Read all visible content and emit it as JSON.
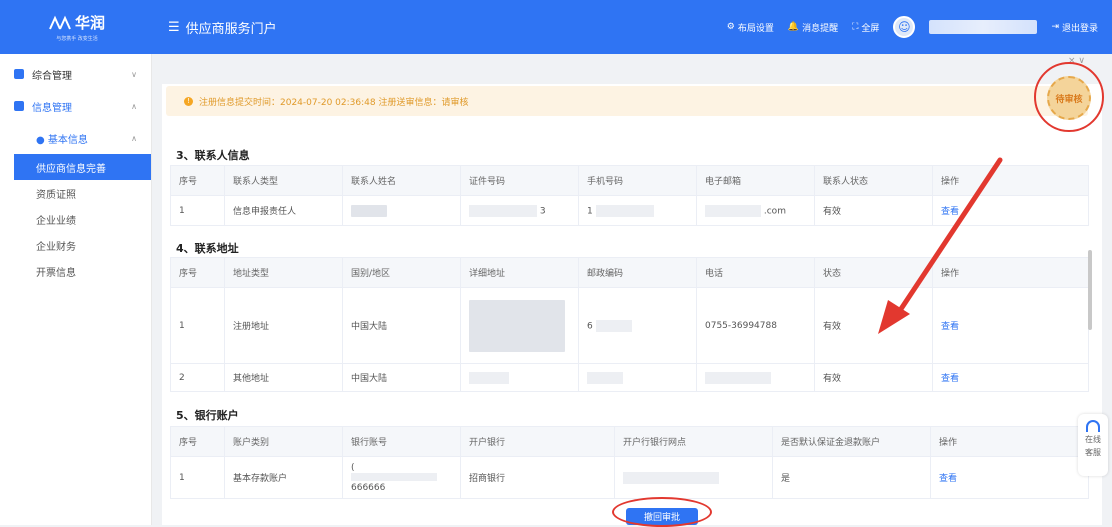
{
  "header": {
    "logo_text": "华润",
    "logo_sub": "与您携手 改变生活",
    "portal_title": "供应商服务门户",
    "layout_settings": "布局设置",
    "messages": "消息提醒",
    "fullscreen": "全屏",
    "logout": "退出登录"
  },
  "sidebar": {
    "items": [
      {
        "label": "综合管理"
      },
      {
        "label": "信息管理"
      },
      {
        "label": "● 基本信息"
      }
    ],
    "sub_items": [
      {
        "label": "供应商信息完善"
      },
      {
        "label": "资质证照"
      },
      {
        "label": "企业业绩"
      },
      {
        "label": "企业财务"
      },
      {
        "label": "开票信息"
      }
    ]
  },
  "notice": {
    "text": "注册信息提交时间：2024-07-20 02:36:48 注册送审信息：请审核"
  },
  "stamp": {
    "text": "待审核"
  },
  "contacts": {
    "title": "3、联系人信息",
    "headers": [
      "序号",
      "联系人类型",
      "联系人姓名",
      "证件号码",
      "手机号码",
      "电子邮箱",
      "联系人状态",
      "操作"
    ],
    "rows": [
      {
        "no": "1",
        "type": "信息申报责任人",
        "id_tail": "3",
        "phone_head": "1",
        "email_tail": ".com",
        "status": "有效",
        "action": "查看"
      }
    ]
  },
  "addresses": {
    "title": "4、联系地址",
    "headers": [
      "序号",
      "地址类型",
      "国别/地区",
      "详细地址",
      "邮政编码",
      "电话",
      "状态",
      "操作"
    ],
    "rows": [
      {
        "no": "1",
        "type": "注册地址",
        "region": "中国大陆",
        "postal_head": "6",
        "phone": "0755-36994788",
        "status": "有效",
        "action": "查看"
      },
      {
        "no": "2",
        "type": "其他地址",
        "region": "中国大陆",
        "status": "有效",
        "action": "查看"
      }
    ]
  },
  "bank": {
    "title": "5、银行账户",
    "headers": [
      "序号",
      "账户类别",
      "银行账号",
      "开户银行",
      "开户行银行网点",
      "是否默认保证金退款账户",
      "操作"
    ],
    "rows": [
      {
        "no": "1",
        "type": "基本存款账户",
        "account_head": "(",
        "account_tail": "666666",
        "bank": "招商银行",
        "is_default": "是",
        "action": "查看"
      }
    ]
  },
  "footer": {
    "submit": "撤回审批"
  },
  "service": {
    "line1": "在线",
    "line2": "客服"
  },
  "colors": {
    "primary": "#2f74f3",
    "annotation_red": "#e2382f",
    "notice_bg": "#fdf3e3",
    "notice_text": "#e09a2a"
  }
}
